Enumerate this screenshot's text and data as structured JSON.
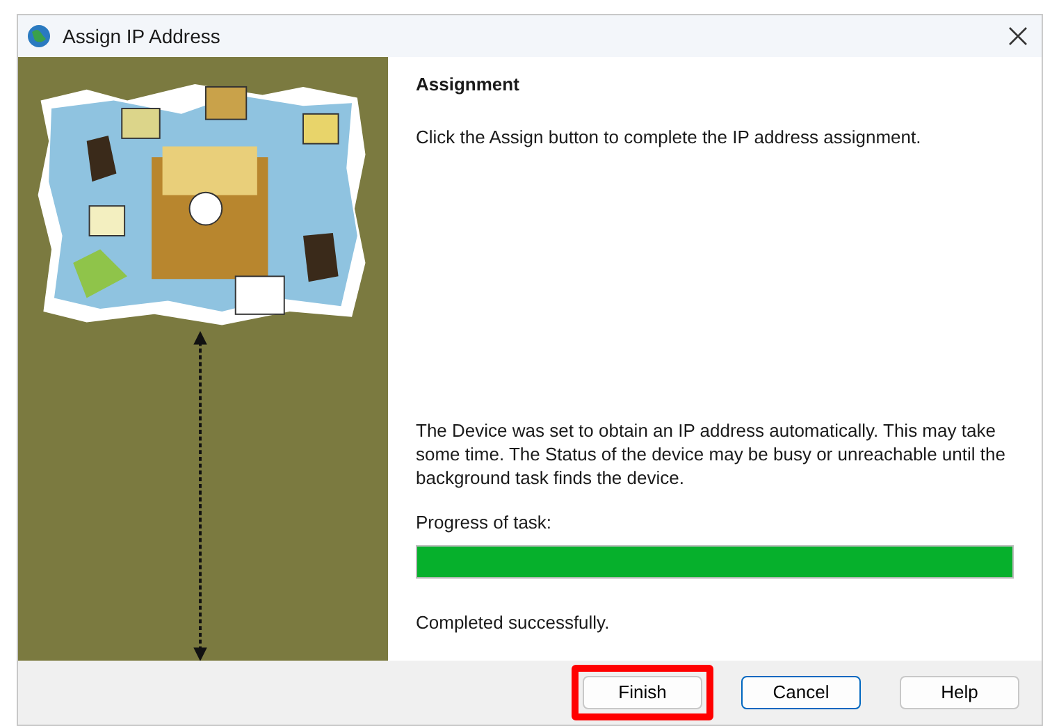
{
  "window": {
    "title": "Assign IP Address"
  },
  "page": {
    "heading": "Assignment",
    "instruction": "Click the Assign button to complete the IP address assignment.",
    "notice": "The Device was set to obtain an IP address automatically. This may take some time. The Status of the device may be busy or unreachable until the background task finds the device.",
    "progress_label": "Progress of task:",
    "progress": {
      "level": 1
    },
    "result": "Completed successfully."
  },
  "buttons": [
    {
      "label": "Finish",
      "highlighted": true,
      "focused": false
    },
    {
      "label": "Cancel",
      "highlighted": false,
      "focused": true
    },
    {
      "label": "Help",
      "highlighted": false,
      "focused": false
    }
  ]
}
